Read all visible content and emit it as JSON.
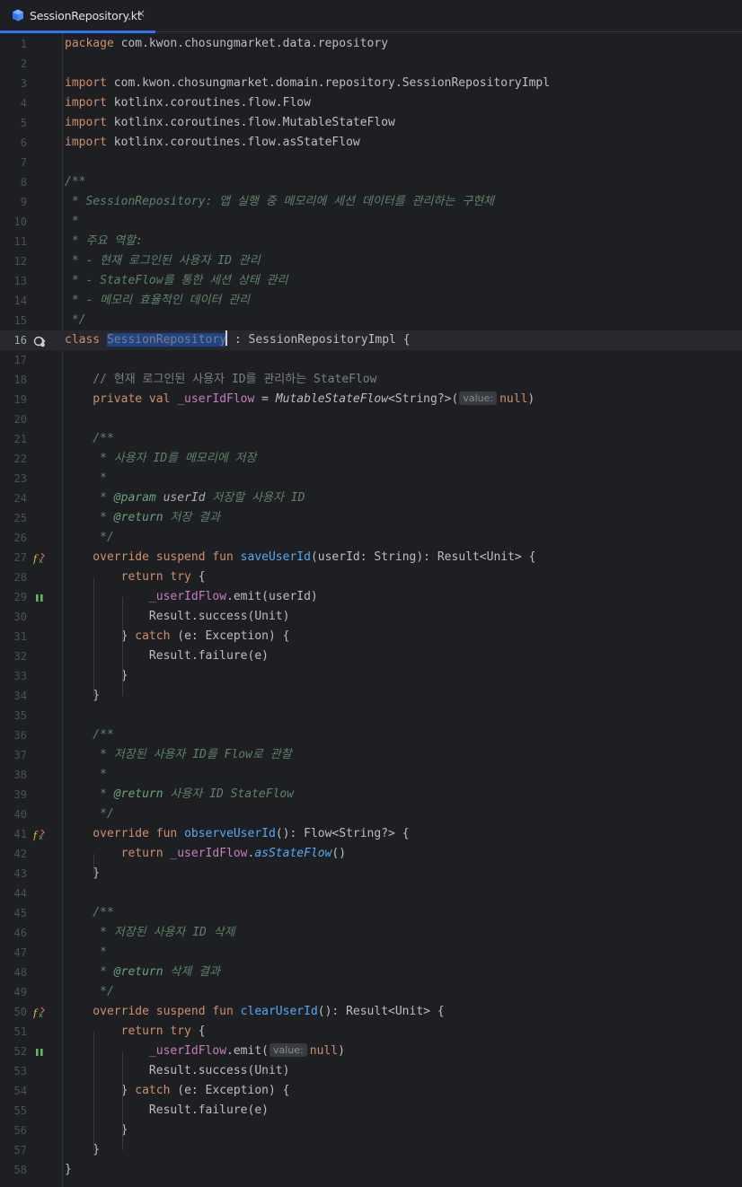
{
  "tab": {
    "title": "SessionRepository.kt",
    "close_glyph": "×",
    "icon": "kotlin-file-icon"
  },
  "hint_label": "value:",
  "lines": [
    {
      "n": "1",
      "segs": [
        [
          "kw",
          "package"
        ],
        [
          "",
          " com.kwon.chosungmarket.data.repository"
        ]
      ]
    },
    {
      "n": "2",
      "segs": []
    },
    {
      "n": "3",
      "segs": [
        [
          "kw",
          "import"
        ],
        [
          "",
          " com.kwon.chosungmarket.domain.repository.SessionRepositoryImpl"
        ]
      ]
    },
    {
      "n": "4",
      "segs": [
        [
          "kw",
          "import"
        ],
        [
          "",
          " kotlinx.coroutines.flow.Flow"
        ]
      ]
    },
    {
      "n": "5",
      "segs": [
        [
          "kw",
          "import"
        ],
        [
          "",
          " kotlinx.coroutines.flow.MutableStateFlow"
        ]
      ]
    },
    {
      "n": "6",
      "segs": [
        [
          "kw",
          "import"
        ],
        [
          "",
          " kotlinx.coroutines.flow.asStateFlow"
        ]
      ]
    },
    {
      "n": "7",
      "segs": []
    },
    {
      "n": "8",
      "segs": [
        [
          "doc",
          "/**"
        ]
      ]
    },
    {
      "n": "9",
      "segs": [
        [
          "doc",
          " * SessionRepository: 앱 실행 중 메모리에 세션 데이터를 관리하는 구현체"
        ]
      ]
    },
    {
      "n": "10",
      "segs": [
        [
          "doc",
          " *"
        ]
      ]
    },
    {
      "n": "11",
      "segs": [
        [
          "doc",
          " * 주요 역할:"
        ]
      ]
    },
    {
      "n": "12",
      "segs": [
        [
          "doc",
          " * - 현재 로그인된 사용자 ID 관리"
        ]
      ]
    },
    {
      "n": "13",
      "segs": [
        [
          "doc",
          " * - StateFlow를 통한 세션 상태 관리"
        ]
      ]
    },
    {
      "n": "14",
      "segs": [
        [
          "doc",
          " * - 메모리 효율적인 데이터 관리"
        ]
      ]
    },
    {
      "n": "15",
      "segs": [
        [
          "doc",
          " */"
        ]
      ]
    },
    {
      "n": "16",
      "current": true,
      "icon": "implemented-icon",
      "segs": [
        [
          "kw",
          "class"
        ],
        [
          "",
          " "
        ],
        [
          "sel",
          "SessionRepository"
        ],
        [
          "caret",
          ""
        ],
        [
          "",
          " : SessionRepositoryImpl {"
        ]
      ]
    },
    {
      "n": "17",
      "segs": []
    },
    {
      "n": "18",
      "segs": [
        [
          "cm",
          "    // 현재 로그인된 사용자 ID를 관리하는 StateFlow"
        ]
      ]
    },
    {
      "n": "19",
      "segs": [
        [
          "kw",
          "    private val"
        ],
        [
          "",
          " "
        ],
        [
          "prop",
          "_userIdFlow"
        ],
        [
          "",
          " = "
        ],
        [
          "it",
          "MutableStateFlow"
        ],
        [
          "",
          "<String?>("
        ],
        [
          "hint",
          "value:"
        ],
        [
          "kw",
          "null"
        ],
        [
          "",
          ")"
        ]
      ]
    },
    {
      "n": "20",
      "segs": []
    },
    {
      "n": "21",
      "segs": [
        [
          "doc",
          "    /**"
        ]
      ]
    },
    {
      "n": "22",
      "segs": [
        [
          "doc",
          "     * 사용자 ID를 메모리에 저장"
        ]
      ]
    },
    {
      "n": "23",
      "segs": [
        [
          "doc",
          "     *"
        ]
      ]
    },
    {
      "n": "24",
      "segs": [
        [
          "doc",
          "     * "
        ],
        [
          "doctag",
          "@param"
        ],
        [
          "doc",
          " "
        ],
        [
          "docparam",
          "userId"
        ],
        [
          "doc",
          " 저장할 사용자 ID"
        ]
      ]
    },
    {
      "n": "25",
      "segs": [
        [
          "doc",
          "     * "
        ],
        [
          "doctag",
          "@return"
        ],
        [
          "doc",
          " 저장 결과"
        ]
      ]
    },
    {
      "n": "26",
      "segs": [
        [
          "doc",
          "     */"
        ]
      ]
    },
    {
      "n": "27",
      "icon": "override-suspend-icon",
      "segs": [
        [
          "kw",
          "    override suspend fun"
        ],
        [
          "",
          " "
        ],
        [
          "fn",
          "saveUserId"
        ],
        [
          "",
          "(userId: String): Result<Unit> {"
        ]
      ]
    },
    {
      "n": "28",
      "segs": [
        [
          "kw",
          "        return try"
        ],
        [
          "",
          " {"
        ]
      ]
    },
    {
      "n": "29",
      "icon": "suspend-call-icon",
      "segs": [
        [
          "",
          "            "
        ],
        [
          "prop",
          "_userIdFlow"
        ],
        [
          "",
          ".emit(userId)"
        ]
      ]
    },
    {
      "n": "30",
      "segs": [
        [
          "",
          "            Result.success(Unit)"
        ]
      ]
    },
    {
      "n": "31",
      "segs": [
        [
          "",
          "        } "
        ],
        [
          "kw",
          "catch"
        ],
        [
          "",
          " (e: Exception) {"
        ]
      ]
    },
    {
      "n": "32",
      "segs": [
        [
          "",
          "            Result.failure(e)"
        ]
      ]
    },
    {
      "n": "33",
      "segs": [
        [
          "",
          "        }"
        ]
      ]
    },
    {
      "n": "34",
      "segs": [
        [
          "",
          "    }"
        ]
      ]
    },
    {
      "n": "35",
      "segs": []
    },
    {
      "n": "36",
      "segs": [
        [
          "doc",
          "    /**"
        ]
      ]
    },
    {
      "n": "37",
      "segs": [
        [
          "doc",
          "     * 저장된 사용자 ID를 Flow로 관찰"
        ]
      ]
    },
    {
      "n": "38",
      "segs": [
        [
          "doc",
          "     *"
        ]
      ]
    },
    {
      "n": "39",
      "segs": [
        [
          "doc",
          "     * "
        ],
        [
          "doctag",
          "@return"
        ],
        [
          "doc",
          " 사용자 ID StateFlow"
        ]
      ]
    },
    {
      "n": "40",
      "segs": [
        [
          "doc",
          "     */"
        ]
      ]
    },
    {
      "n": "41",
      "icon": "override-icon",
      "segs": [
        [
          "kw",
          "    override fun"
        ],
        [
          "",
          " "
        ],
        [
          "fn",
          "observeUserId"
        ],
        [
          "",
          "(): Flow<String?> {"
        ]
      ]
    },
    {
      "n": "42",
      "segs": [
        [
          "kw",
          "        return"
        ],
        [
          "",
          " "
        ],
        [
          "prop",
          "_userIdFlow"
        ],
        [
          "",
          "."
        ],
        [
          "ext",
          "asStateFlow"
        ],
        [
          "",
          "()"
        ]
      ]
    },
    {
      "n": "43",
      "segs": [
        [
          "",
          "    }"
        ]
      ]
    },
    {
      "n": "44",
      "segs": []
    },
    {
      "n": "45",
      "segs": [
        [
          "doc",
          "    /**"
        ]
      ]
    },
    {
      "n": "46",
      "segs": [
        [
          "doc",
          "     * 저장된 사용자 ID 삭제"
        ]
      ]
    },
    {
      "n": "47",
      "segs": [
        [
          "doc",
          "     *"
        ]
      ]
    },
    {
      "n": "48",
      "segs": [
        [
          "doc",
          "     * "
        ],
        [
          "doctag",
          "@return"
        ],
        [
          "doc",
          " 삭제 결과"
        ]
      ]
    },
    {
      "n": "49",
      "segs": [
        [
          "doc",
          "     */"
        ]
      ]
    },
    {
      "n": "50",
      "icon": "override-suspend-icon",
      "segs": [
        [
          "kw",
          "    override suspend fun"
        ],
        [
          "",
          " "
        ],
        [
          "fn",
          "clearUserId"
        ],
        [
          "",
          "(): Result<Unit> {"
        ]
      ]
    },
    {
      "n": "51",
      "segs": [
        [
          "kw",
          "        return try"
        ],
        [
          "",
          " {"
        ]
      ]
    },
    {
      "n": "52",
      "icon": "suspend-call-icon",
      "segs": [
        [
          "",
          "            "
        ],
        [
          "prop",
          "_userIdFlow"
        ],
        [
          "",
          ".emit("
        ],
        [
          "hint",
          "value:"
        ],
        [
          "kw",
          "null"
        ],
        [
          "",
          ")"
        ]
      ]
    },
    {
      "n": "53",
      "segs": [
        [
          "",
          "            Result.success(Unit)"
        ]
      ]
    },
    {
      "n": "54",
      "segs": [
        [
          "",
          "        } "
        ],
        [
          "kw",
          "catch"
        ],
        [
          "",
          " (e: Exception) {"
        ]
      ]
    },
    {
      "n": "55",
      "segs": [
        [
          "",
          "            Result.failure(e)"
        ]
      ]
    },
    {
      "n": "56",
      "segs": [
        [
          "",
          "        }"
        ]
      ]
    },
    {
      "n": "57",
      "segs": [
        [
          "",
          "    }"
        ]
      ]
    },
    {
      "n": "58",
      "segs": [
        [
          "",
          "}"
        ]
      ]
    }
  ]
}
